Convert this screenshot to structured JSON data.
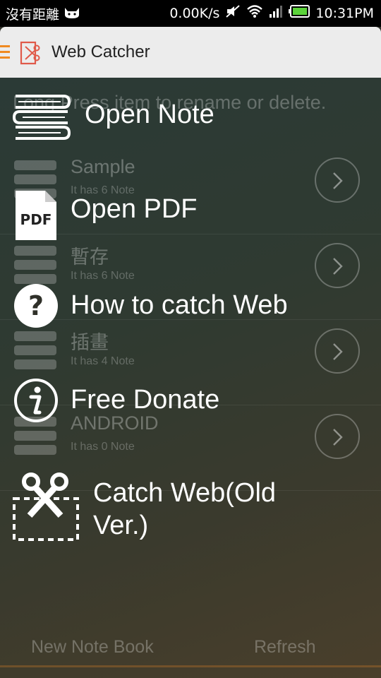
{
  "status_bar": {
    "carrier": "沒有距離",
    "network_speed": "0.00K/s",
    "time": "10:31PM"
  },
  "app_bar": {
    "title": "Web Catcher"
  },
  "hint": "Long Press item to rename or delete.",
  "notebooks": [
    {
      "name": "Sample",
      "count": "It has 6 Note"
    },
    {
      "name": "暫存",
      "count": "It has 6 Note"
    },
    {
      "name": "插畫",
      "count": "It has 4 Note"
    },
    {
      "name": "ANDROID",
      "count": "It has 0 Note"
    }
  ],
  "bottom": {
    "new_note_book": "New Note Book",
    "refresh": "Refresh"
  },
  "drawer": {
    "open_note": "Open Note",
    "open_pdf": "Open PDF",
    "pdf_icon_text": "PDF",
    "how_to": "How to catch Web",
    "free_donate": "Free Donate",
    "catch_web_line1": "Catch Web(Old",
    "catch_web_line2": "Ver.)"
  },
  "colors": {
    "accent": "#f08a21",
    "logo": "#e05a4a"
  },
  "icons": [
    "menu-icon",
    "scissors-logo-icon",
    "books-icon",
    "pdf-icon",
    "question-icon",
    "info-icon",
    "scissors-crop-icon",
    "chevron-right-icon",
    "wifi-icon",
    "signal-icon",
    "battery-icon",
    "mute-icon",
    "cat-icon"
  ]
}
